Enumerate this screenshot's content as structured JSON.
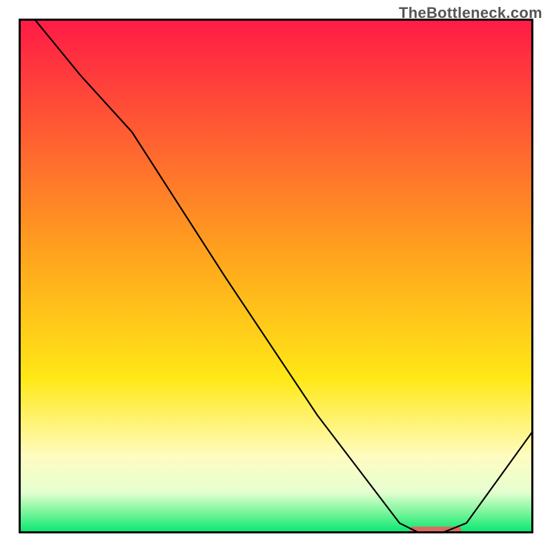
{
  "watermark": "TheBottleneck.com",
  "chart_data": {
    "type": "line",
    "title": "",
    "xlabel": "",
    "ylabel": "",
    "xlim": [
      0,
      100
    ],
    "ylim": [
      0,
      100
    ],
    "axes_visible": false,
    "background_gradient": {
      "stops": [
        {
          "offset": 0,
          "color": "#ff1a46"
        },
        {
          "offset": 45,
          "color": "#ffa11e"
        },
        {
          "offset": 70,
          "color": "#ffe817"
        },
        {
          "offset": 85,
          "color": "#fffcc0"
        },
        {
          "offset": 92,
          "color": "#e5ffd0"
        },
        {
          "offset": 96,
          "color": "#77f59a"
        },
        {
          "offset": 100,
          "color": "#00e56e"
        }
      ]
    },
    "series": [
      {
        "name": "curve",
        "color": "#000000",
        "stroke_width": 2.2,
        "x": [
          3,
          12,
          22,
          40,
          58,
          74,
          78,
          82,
          87,
          100
        ],
        "y": [
          100,
          89,
          78,
          50,
          23,
          2,
          0,
          0,
          2,
          20
        ]
      }
    ],
    "markers": [
      {
        "name": "flat-min-bar",
        "type": "bar",
        "color": "#d96a60",
        "x_start": 76,
        "x_end": 86,
        "y": 0,
        "height": 1.3
      }
    ]
  }
}
